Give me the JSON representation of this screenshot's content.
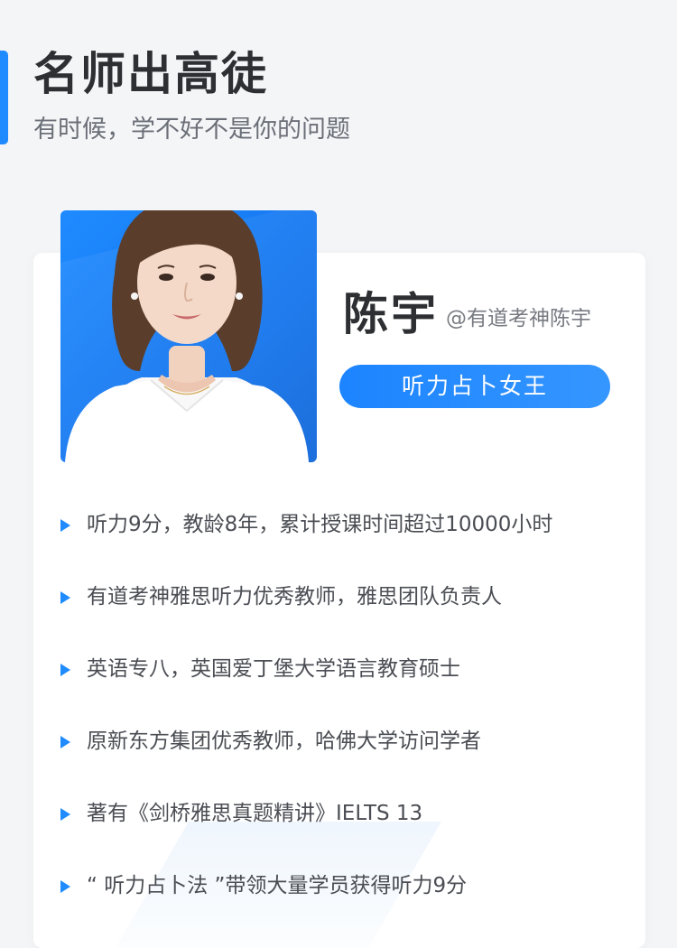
{
  "section": {
    "title": "名师出高徒",
    "subtitle": "有时候，学不好不是你的问题"
  },
  "teacher": {
    "name": "陈宇",
    "handle": "@有道考神陈宇",
    "badge": "听力占卜女王",
    "photo_icon": "teacher-portrait"
  },
  "credentials": [
    "听力9分，教龄8年，累计授课时间超过10000小时",
    "有道考神雅思听力优秀教师，雅思团队负责人",
    "英语专八，英国爱丁堡大学语言教育硕士",
    "原新东方集团优秀教师，哈佛大学访问学者",
    "著有《剑桥雅思真题精讲》IELTS  13",
    "“ 听力占卜法 ”带领大量学员获得听力9分"
  ],
  "colors": {
    "accent": "#1f8bff",
    "background": "#f4f5f7",
    "card": "#ffffff",
    "title": "#2d2f33",
    "body_text": "#4a4d53"
  }
}
